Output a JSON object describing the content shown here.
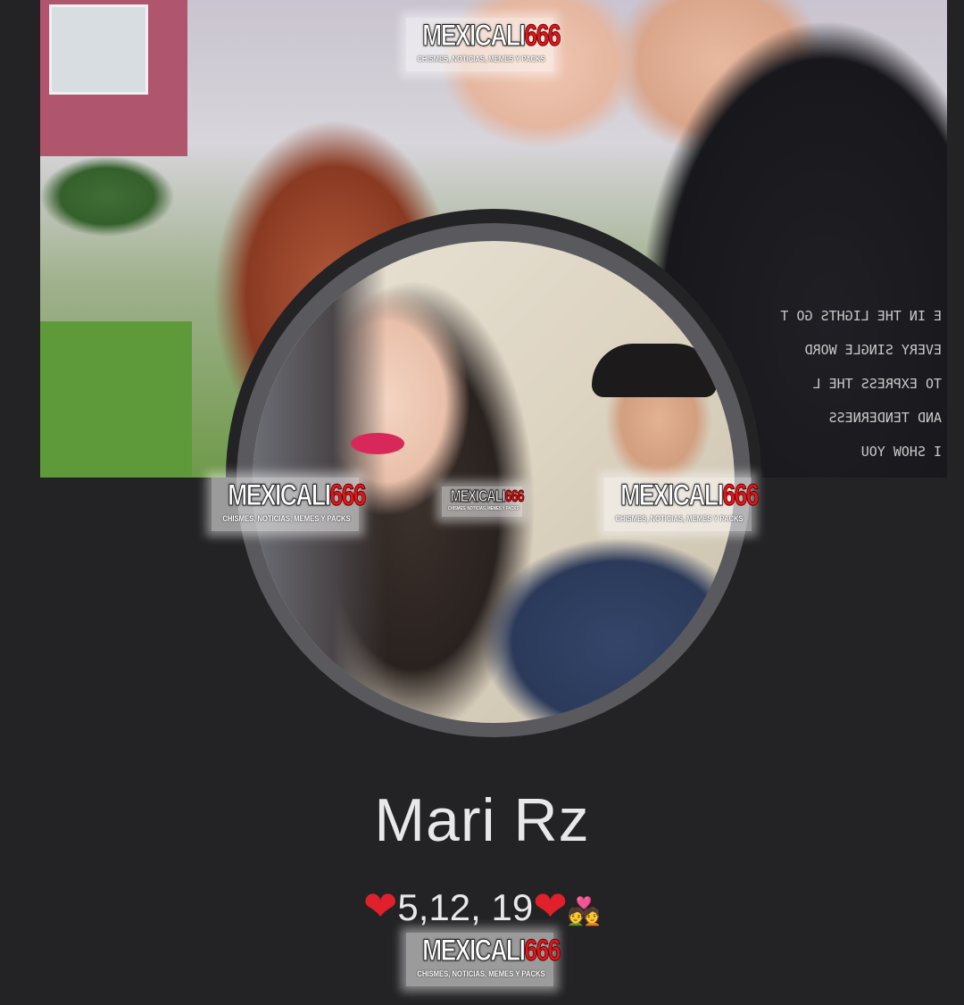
{
  "profile": {
    "name": "Mari Rz",
    "bio_text": "5,12, 19",
    "bio_heart_left": "❤",
    "bio_heart_right": "❤",
    "bio_emoji": "💑"
  },
  "watermark": {
    "word": "MEXICALI",
    "number": "666",
    "tagline": "CHISMES, NOTICIAS, MEMES Y PACKS"
  },
  "cover_photo": {
    "hoodie_text": "E IN THE LIGHTS GO T\nEVERY SINGLE WORD\nTO EXPRESS THE L\nAND TENDERNESS\nI SHOW YOU"
  },
  "colors": {
    "background": "#232325",
    "avatar_ring": "#5a5a5e",
    "name_text": "#e8e8ea",
    "heart": "#e0202a",
    "watermark_number": "#e4161c"
  }
}
